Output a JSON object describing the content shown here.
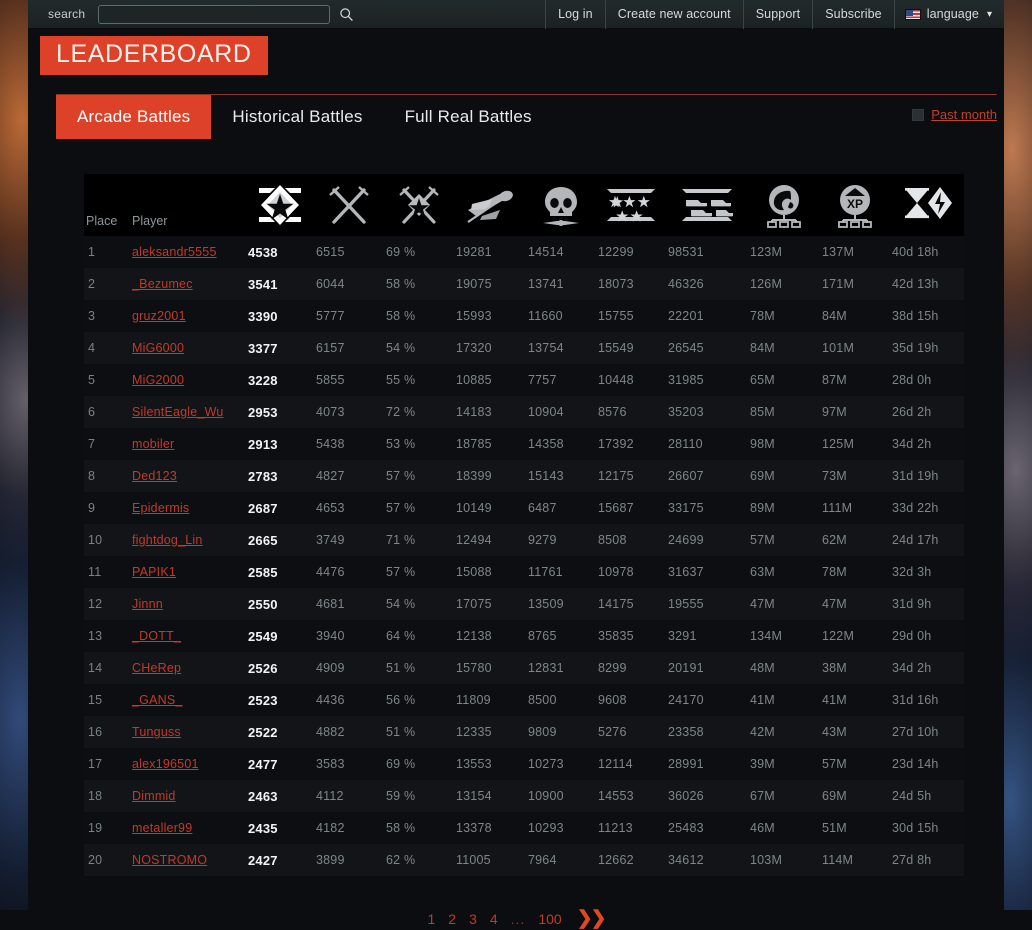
{
  "topnav": {
    "search_label": "search",
    "search_value": "",
    "search_placeholder": "",
    "search_icon": "search-icon",
    "links": [
      {
        "label": "Log in"
      },
      {
        "label": "Create new account"
      },
      {
        "label": "Support"
      },
      {
        "label": "Subscribe"
      }
    ],
    "language": {
      "label": "language",
      "flag": "us-flag-icon",
      "chevron": "▾"
    }
  },
  "header": {
    "title": "LEADERBOARD"
  },
  "tabs": [
    {
      "label": "Arcade Battles",
      "active": true
    },
    {
      "label": "Historical Battles",
      "active": false
    },
    {
      "label": "Full Real Battles",
      "active": false
    }
  ],
  "filter": {
    "past_month_label": "Past month",
    "checked": false
  },
  "table": {
    "columns": [
      {
        "key": "place",
        "label": "Place",
        "icon": null
      },
      {
        "key": "player",
        "label": "Player",
        "icon": null
      },
      {
        "key": "rating",
        "label": "",
        "icon": "rating-badge-icon"
      },
      {
        "key": "battles",
        "label": "",
        "icon": "crossed-swords-icon"
      },
      {
        "key": "winrate",
        "label": "",
        "icon": "crossed-swords-victory-icon"
      },
      {
        "key": "air",
        "label": "",
        "icon": "airplane-icon"
      },
      {
        "key": "deaths",
        "label": "",
        "icon": "skull-propeller-icon"
      },
      {
        "key": "stars",
        "label": "",
        "icon": "five-stars-icon"
      },
      {
        "key": "ground",
        "label": "",
        "icon": "ground-vehicles-icon"
      },
      {
        "key": "lions",
        "label": "",
        "icon": "lion-head-icon"
      },
      {
        "key": "xp",
        "label": "",
        "icon": "xp-icon"
      },
      {
        "key": "time",
        "label": "",
        "icon": "hourglass-lightning-icon"
      }
    ],
    "rows": [
      {
        "place": "1",
        "player": "aleksandr5555",
        "rating": "4538",
        "battles": "6515",
        "winrate": "69 %",
        "air": "19281",
        "deaths": "14514",
        "stars": "12299",
        "ground": "98531",
        "lions": "123M",
        "xp": "137M",
        "time": "40d 18h"
      },
      {
        "place": "2",
        "player": "_Bezumec",
        "rating": "3541",
        "battles": "6044",
        "winrate": "58 %",
        "air": "19075",
        "deaths": "13741",
        "stars": "18073",
        "ground": "46326",
        "lions": "126M",
        "xp": "171M",
        "time": "42d 13h"
      },
      {
        "place": "3",
        "player": "gruz2001",
        "rating": "3390",
        "battles": "5777",
        "winrate": "58 %",
        "air": "15993",
        "deaths": "11660",
        "stars": "15755",
        "ground": "22201",
        "lions": "78M",
        "xp": "84M",
        "time": "38d 15h"
      },
      {
        "place": "4",
        "player": "MiG6000",
        "rating": "3377",
        "battles": "6157",
        "winrate": "54 %",
        "air": "17320",
        "deaths": "13754",
        "stars": "15549",
        "ground": "26545",
        "lions": "84M",
        "xp": "101M",
        "time": "35d 19h"
      },
      {
        "place": "5",
        "player": "MiG2000",
        "rating": "3228",
        "battles": "5855",
        "winrate": "55 %",
        "air": "10885",
        "deaths": "7757",
        "stars": "10448",
        "ground": "31985",
        "lions": "65M",
        "xp": "87M",
        "time": "28d 0h"
      },
      {
        "place": "6",
        "player": "SilentEagle_Wu",
        "rating": "2953",
        "battles": "4073",
        "winrate": "72 %",
        "air": "14183",
        "deaths": "10904",
        "stars": "8576",
        "ground": "35203",
        "lions": "85M",
        "xp": "97M",
        "time": "26d 2h"
      },
      {
        "place": "7",
        "player": "mobiler",
        "rating": "2913",
        "battles": "5438",
        "winrate": "53 %",
        "air": "18785",
        "deaths": "14358",
        "stars": "17392",
        "ground": "28110",
        "lions": "98M",
        "xp": "125M",
        "time": "34d 2h"
      },
      {
        "place": "8",
        "player": "Ded123",
        "rating": "2783",
        "battles": "4827",
        "winrate": "57 %",
        "air": "18399",
        "deaths": "15143",
        "stars": "12175",
        "ground": "26607",
        "lions": "69M",
        "xp": "73M",
        "time": "31d 19h"
      },
      {
        "place": "9",
        "player": "Epidermis",
        "rating": "2687",
        "battles": "4653",
        "winrate": "57 %",
        "air": "10149",
        "deaths": "6487",
        "stars": "15687",
        "ground": "33175",
        "lions": "89M",
        "xp": "111M",
        "time": "33d 22h"
      },
      {
        "place": "10",
        "player": "fightdog_Lin",
        "rating": "2665",
        "battles": "3749",
        "winrate": "71 %",
        "air": "12494",
        "deaths": "9279",
        "stars": "8508",
        "ground": "24699",
        "lions": "57M",
        "xp": "62M",
        "time": "24d 17h"
      },
      {
        "place": "11",
        "player": "PAPIK1",
        "rating": "2585",
        "battles": "4476",
        "winrate": "57 %",
        "air": "15088",
        "deaths": "11761",
        "stars": "10978",
        "ground": "31637",
        "lions": "63M",
        "xp": "78M",
        "time": "32d 3h"
      },
      {
        "place": "12",
        "player": "Jinnn",
        "rating": "2550",
        "battles": "4681",
        "winrate": "54 %",
        "air": "17075",
        "deaths": "13509",
        "stars": "14175",
        "ground": "19555",
        "lions": "47M",
        "xp": "47M",
        "time": "31d 9h"
      },
      {
        "place": "13",
        "player": "_DOTT_",
        "rating": "2549",
        "battles": "3940",
        "winrate": "64 %",
        "air": "12138",
        "deaths": "8765",
        "stars": "35835",
        "ground": "3291",
        "lions": "134M",
        "xp": "122M",
        "time": "29d 0h"
      },
      {
        "place": "14",
        "player": "CHeRep",
        "rating": "2526",
        "battles": "4909",
        "winrate": "51 %",
        "air": "15780",
        "deaths": "12831",
        "stars": "8299",
        "ground": "20191",
        "lions": "48M",
        "xp": "38M",
        "time": "34d 2h"
      },
      {
        "place": "15",
        "player": "_GANS_",
        "rating": "2523",
        "battles": "4436",
        "winrate": "56 %",
        "air": "11809",
        "deaths": "8500",
        "stars": "9608",
        "ground": "24170",
        "lions": "41M",
        "xp": "41M",
        "time": "31d 16h"
      },
      {
        "place": "16",
        "player": "Tunguss",
        "rating": "2522",
        "battles": "4882",
        "winrate": "51 %",
        "air": "12335",
        "deaths": "9809",
        "stars": "5276",
        "ground": "23358",
        "lions": "42M",
        "xp": "43M",
        "time": "27d 10h"
      },
      {
        "place": "17",
        "player": "alex196501",
        "rating": "2477",
        "battles": "3583",
        "winrate": "69 %",
        "air": "13553",
        "deaths": "10273",
        "stars": "12114",
        "ground": "28991",
        "lions": "39M",
        "xp": "57M",
        "time": "23d 14h"
      },
      {
        "place": "18",
        "player": "Dimmid",
        "rating": "2463",
        "battles": "4112",
        "winrate": "59 %",
        "air": "13154",
        "deaths": "10900",
        "stars": "14553",
        "ground": "36026",
        "lions": "67M",
        "xp": "69M",
        "time": "24d 5h"
      },
      {
        "place": "19",
        "player": "metaller99",
        "rating": "2435",
        "battles": "4182",
        "winrate": "58 %",
        "air": "13378",
        "deaths": "10293",
        "stars": "11213",
        "ground": "25483",
        "lions": "46M",
        "xp": "51M",
        "time": "30d 15h"
      },
      {
        "place": "20",
        "player": "NOSTROMO",
        "rating": "2427",
        "battles": "3899",
        "winrate": "62 %",
        "air": "11005",
        "deaths": "7964",
        "stars": "12662",
        "ground": "34612",
        "lions": "103M",
        "xp": "114M",
        "time": "27d 8h"
      }
    ]
  },
  "pagination": {
    "pages": [
      "1",
      "2",
      "3",
      "4"
    ],
    "ellipsis": "...",
    "last_page": "100",
    "next_arrows": "❯❯"
  },
  "colors": {
    "accent": "#dd4228",
    "link": "#c33a26",
    "text": "#7e868a",
    "highlight": "#f2f4f5"
  }
}
